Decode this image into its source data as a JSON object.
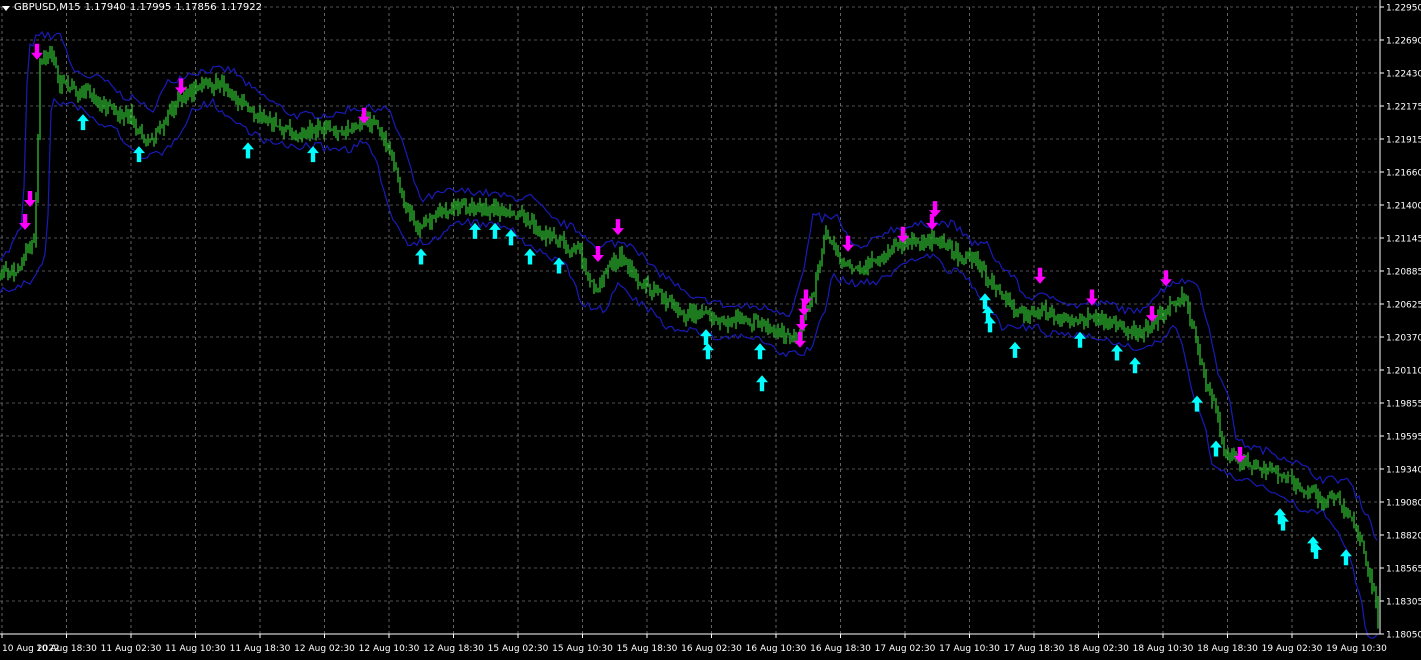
{
  "header": {
    "symbol": "GBPUSD",
    "timeframe": "M15",
    "open": "1.17940",
    "high": "1.17995",
    "low": "1.17856",
    "close": "1.17922"
  },
  "colors": {
    "background": "#000000",
    "grid": "#c0c0c0",
    "candles": "#32cd32",
    "envelope": "#1a1ab8",
    "buy_arrow": "#00ffff",
    "sell_arrow": "#ff00ff",
    "axis_text": "#ffffff"
  },
  "icons": {
    "buy_signal": "up-arrow-icon",
    "sell_signal": "down-arrow-icon"
  },
  "chart_data": {
    "type": "line",
    "series": [],
    "grid": true,
    "price_range": [
      1.1805,
      1.2295
    ],
    "price_ticks": [
      "1.22950",
      "1.22690",
      "1.22430",
      "1.22175",
      "1.21915",
      "1.21660",
      "1.21400",
      "1.21145",
      "1.20885",
      "1.20625",
      "1.20370",
      "1.20110",
      "1.19855",
      "1.19595",
      "1.19340",
      "1.19080",
      "1.18820",
      "1.18565",
      "1.18305",
      "1.18050"
    ],
    "time_labels": [
      "10 Aug 2022",
      "10 Aug 18:30",
      "11 Aug 02:30",
      "11 Aug 10:30",
      "11 Aug 18:30",
      "12 Aug 02:30",
      "12 Aug 10:30",
      "12 Aug 18:30",
      "15 Aug 02:30",
      "15 Aug 10:30",
      "15 Aug 18:30",
      "16 Aug 02:30",
      "16 Aug 10:30",
      "16 Aug 18:30",
      "17 Aug 02:30",
      "17 Aug 10:30",
      "17 Aug 18:30",
      "18 Aug 02:30",
      "18 Aug 10:30",
      "18 Aug 18:30",
      "19 Aug 02:30",
      "19 Aug 10:30"
    ],
    "price_points": [
      [
        0,
        1.2085
      ],
      [
        20,
        1.2092
      ],
      [
        35,
        1.2115
      ],
      [
        40,
        1.225
      ],
      [
        50,
        1.2262
      ],
      [
        60,
        1.2235
      ],
      [
        75,
        1.223
      ],
      [
        90,
        1.2228
      ],
      [
        110,
        1.2215
      ],
      [
        130,
        1.221
      ],
      [
        140,
        1.2195
      ],
      [
        150,
        1.219
      ],
      [
        165,
        1.2205
      ],
      [
        180,
        1.2225
      ],
      [
        200,
        1.2232
      ],
      [
        220,
        1.2235
      ],
      [
        240,
        1.222
      ],
      [
        260,
        1.221
      ],
      [
        280,
        1.22
      ],
      [
        300,
        1.2197
      ],
      [
        320,
        1.22
      ],
      [
        340,
        1.2195
      ],
      [
        360,
        1.2205
      ],
      [
        375,
        1.2205
      ],
      [
        390,
        1.218
      ],
      [
        405,
        1.214
      ],
      [
        420,
        1.2122
      ],
      [
        440,
        1.2135
      ],
      [
        460,
        1.214
      ],
      [
        480,
        1.2138
      ],
      [
        500,
        1.2135
      ],
      [
        520,
        1.2135
      ],
      [
        540,
        1.2118
      ],
      [
        560,
        1.2112
      ],
      [
        580,
        1.2102
      ],
      [
        595,
        1.207
      ],
      [
        605,
        1.209
      ],
      [
        620,
        1.21
      ],
      [
        640,
        1.208
      ],
      [
        660,
        1.207
      ],
      [
        680,
        1.2055
      ],
      [
        700,
        1.2055
      ],
      [
        720,
        1.2048
      ],
      [
        740,
        1.205
      ],
      [
        760,
        1.2048
      ],
      [
        775,
        1.2045
      ],
      [
        790,
        1.2035
      ],
      [
        800,
        1.204
      ],
      [
        815,
        1.2075
      ],
      [
        825,
        1.212
      ],
      [
        840,
        1.2098
      ],
      [
        860,
        1.209
      ],
      [
        880,
        1.2098
      ],
      [
        900,
        1.211
      ],
      [
        920,
        1.2112
      ],
      [
        940,
        1.2115
      ],
      [
        960,
        1.21
      ],
      [
        975,
        1.2098
      ],
      [
        990,
        1.208
      ],
      [
        1000,
        1.2075
      ],
      [
        1015,
        1.2055
      ],
      [
        1030,
        1.2055
      ],
      [
        1045,
        1.2058
      ],
      [
        1060,
        1.205
      ],
      [
        1080,
        1.205
      ],
      [
        1100,
        1.2052
      ],
      [
        1120,
        1.2045
      ],
      [
        1140,
        1.204
      ],
      [
        1155,
        1.205
      ],
      [
        1170,
        1.206
      ],
      [
        1185,
        1.207
      ],
      [
        1195,
        1.204
      ],
      [
        1205,
        1.2
      ],
      [
        1215,
        1.1985
      ],
      [
        1225,
        1.1945
      ],
      [
        1240,
        1.194
      ],
      [
        1260,
        1.1936
      ],
      [
        1280,
        1.193
      ],
      [
        1300,
        1.192
      ],
      [
        1320,
        1.191
      ],
      [
        1335,
        1.1915
      ],
      [
        1350,
        1.1895
      ],
      [
        1360,
        1.188
      ],
      [
        1375,
        1.1835
      ],
      [
        1378,
        1.1815
      ]
    ],
    "signals": {
      "buy": [
        [
          83,
          1.2205
        ],
        [
          139,
          1.218
        ],
        [
          248,
          1.2183
        ],
        [
          313,
          1.218
        ],
        [
          421,
          1.21
        ],
        [
          475,
          1.212
        ],
        [
          495,
          1.212
        ],
        [
          511,
          1.2115
        ],
        [
          530,
          1.21
        ],
        [
          559,
          1.2093
        ],
        [
          706,
          1.2037
        ],
        [
          708,
          1.2026
        ],
        [
          760,
          1.2026
        ],
        [
          762,
          1.2001
        ],
        [
          985,
          1.2065
        ],
        [
          988,
          1.2055
        ],
        [
          990,
          1.2047
        ],
        [
          1015,
          1.2027
        ],
        [
          1080,
          1.2035
        ],
        [
          1117,
          1.2025
        ],
        [
          1135,
          1.2015
        ],
        [
          1197,
          1.1985
        ],
        [
          1216,
          1.195
        ],
        [
          1280,
          1.1897
        ],
        [
          1283,
          1.1892
        ],
        [
          1313,
          1.1875
        ],
        [
          1316,
          1.187
        ],
        [
          1346,
          1.1865
        ]
      ],
      "sell": [
        [
          37,
          1.226
        ],
        [
          30,
          1.2145
        ],
        [
          25,
          1.2127
        ],
        [
          181,
          1.2233
        ],
        [
          364,
          1.221
        ],
        [
          618,
          1.2123
        ],
        [
          598,
          1.2102
        ],
        [
          804,
          1.206
        ],
        [
          806,
          1.2068
        ],
        [
          802,
          1.2048
        ],
        [
          800,
          1.2035
        ],
        [
          848,
          1.211
        ],
        [
          903,
          1.2117
        ],
        [
          932,
          1.2127
        ],
        [
          935,
          1.2137
        ],
        [
          1040,
          1.2085
        ],
        [
          1092,
          1.2068
        ],
        [
          1152,
          1.2055
        ],
        [
          1166,
          1.2083
        ],
        [
          1240,
          1.1945
        ]
      ]
    }
  }
}
